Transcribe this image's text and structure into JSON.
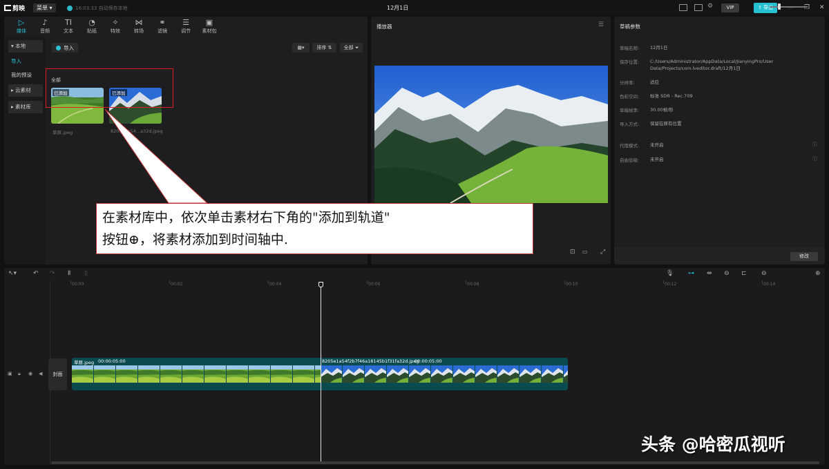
{
  "topbar": {
    "app_name": "剪映",
    "menu_label": "菜单",
    "save_status": "16:03:33 自动保存本地",
    "project_title": "12月1日",
    "vip_label": "VIP",
    "export_label": "导出"
  },
  "toolbar_tabs": [
    {
      "icon": "media-icon",
      "glyph": "▷",
      "label": "媒体",
      "active": true
    },
    {
      "icon": "audio-icon",
      "glyph": "♪",
      "label": "音频"
    },
    {
      "icon": "text-icon",
      "glyph": "TI",
      "label": "文本"
    },
    {
      "icon": "sticker-icon",
      "glyph": "◔",
      "label": "贴纸"
    },
    {
      "icon": "effects-icon",
      "glyph": "✧",
      "label": "特效"
    },
    {
      "icon": "transition-icon",
      "glyph": "⋈",
      "label": "转场"
    },
    {
      "icon": "filter-icon",
      "glyph": "⚭",
      "label": "滤镜"
    },
    {
      "icon": "adjust-icon",
      "glyph": "☰",
      "label": "调节"
    },
    {
      "icon": "material-pack-icon",
      "glyph": "▣",
      "label": "素材包"
    }
  ],
  "side_nav": {
    "local": "本地",
    "import": "导入",
    "my_presets": "我的预设",
    "cloud": "云素材",
    "library": "素材库"
  },
  "media": {
    "import_label": "导入",
    "sort_label": "排序",
    "filter_label": "全部",
    "all_label": "全部",
    "added_tag": "已添加",
    "items": [
      {
        "name": "草原.jpeg"
      },
      {
        "name": "8205e1a54...a32d.jpeg"
      }
    ]
  },
  "player": {
    "title": "播放器"
  },
  "draft": {
    "title": "草稿参数",
    "rows": [
      {
        "key": "草稿名称:",
        "value": "12月1日"
      },
      {
        "key": "保存位置:",
        "value": "C:/Users/Administrator/AppData/Local/JianyingPro/User Data/Projects/com.lveditor.draft/12月1日"
      },
      {
        "key": "分辨率:",
        "value": "适应"
      },
      {
        "key": "色彩空间:",
        "value": "标准 SDR - Rec.709"
      },
      {
        "key": "草稿帧率:",
        "value": "30.00帧/秒"
      },
      {
        "key": "导入方式:",
        "value": "保留在原有位置"
      },
      {
        "key": "代理模式:",
        "value": "未开启"
      },
      {
        "key": "自由层级:",
        "value": "未开启"
      }
    ],
    "modify_label": "修改"
  },
  "timeline": {
    "ruler": [
      "00:00",
      "00:02",
      "00:04",
      "00:06",
      "00:08",
      "00:10",
      "00:12",
      "00:14"
    ],
    "cover_label": "封面",
    "clips": [
      {
        "name": "草原.jpeg",
        "duration": "00:00:05:00"
      },
      {
        "name": "8205e1a54f2b7f46a18145b1f31fa32d.jpeg",
        "duration": "00:00:05:00"
      }
    ]
  },
  "callout": {
    "line1": "在素材库中，依次单击素材右下角的\"添加到轨道\"",
    "line2": "按钮⊕，将素材添加到时间轴中."
  },
  "watermark": "头条 @哈密瓜视听",
  "colors": {
    "accent": "#2bc0d3",
    "annotation_red": "#e02020",
    "clip_track": "#0b4b50"
  }
}
